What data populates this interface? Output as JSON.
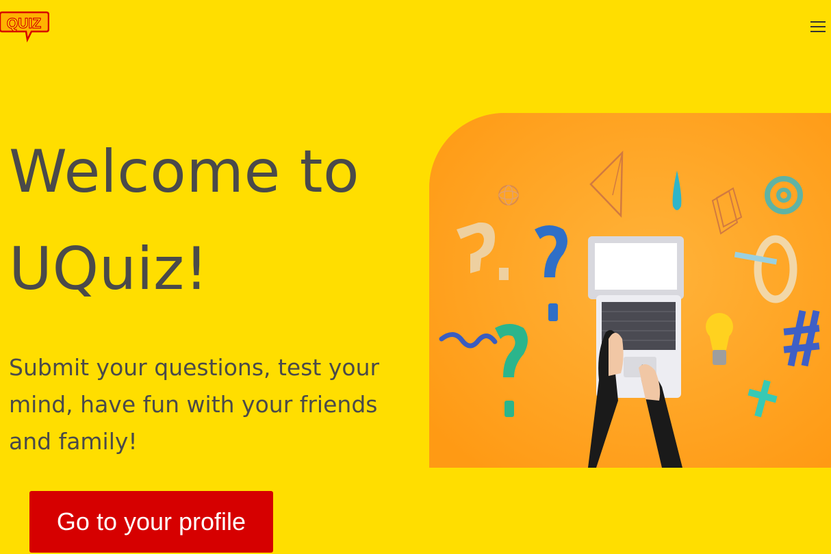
{
  "header": {
    "logo_text": "QUIZ",
    "menu_icon": "hamburger-menu-icon"
  },
  "hero": {
    "headline": "Welcome to UQuiz!",
    "tagline": "Submit your questions, test your mind, have fun with your friends and family!",
    "cta_label": "Go to your profile",
    "image_icon": "laptop-quiz-illustration"
  },
  "colors": {
    "background": "#FFDE00",
    "cta": "#D60000",
    "text": "#4a4a4a",
    "image_bg": "#FFA31F"
  }
}
